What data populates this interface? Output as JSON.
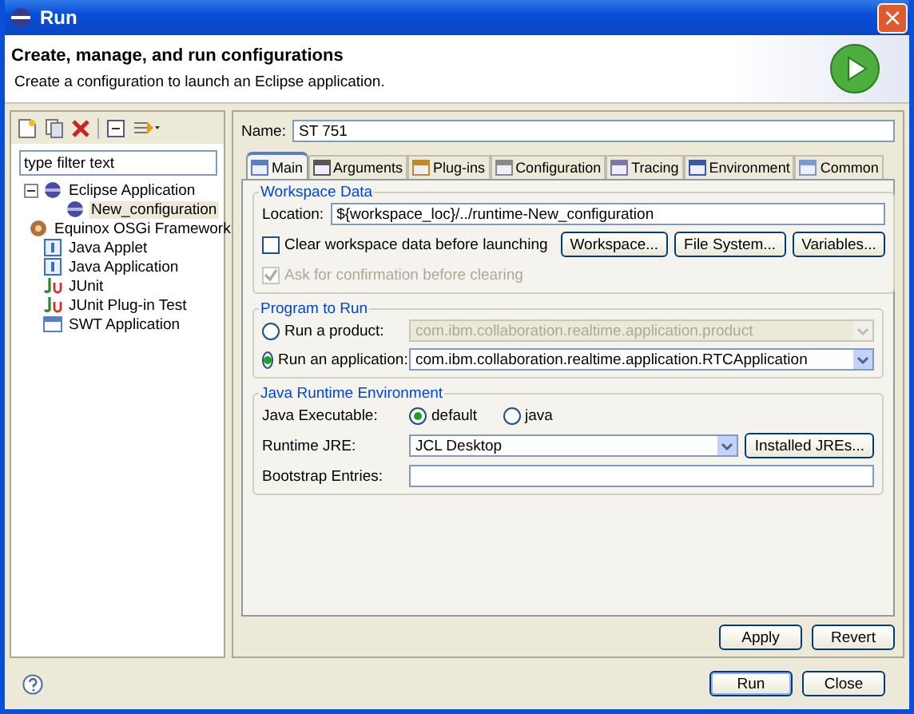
{
  "window": {
    "title": "Run",
    "close": "×"
  },
  "header": {
    "title": "Create, manage, and run configurations",
    "description": "Create a configuration to launch an Eclipse application."
  },
  "filter": {
    "placeholder": "type filter text"
  },
  "tree": [
    {
      "label": "Eclipse Application",
      "kind": "eclipse",
      "expanded": true,
      "selected": false,
      "children": [
        {
          "label": "New_configuration",
          "kind": "config",
          "selected": true
        }
      ]
    },
    {
      "label": "Equinox OSGi Framework",
      "kind": "osgi",
      "selected": false
    },
    {
      "label": "Java Applet",
      "kind": "applet",
      "selected": false
    },
    {
      "label": "Java Application",
      "kind": "java",
      "selected": false
    },
    {
      "label": "JUnit",
      "kind": "junit",
      "selected": false
    },
    {
      "label": "JUnit Plug-in Test",
      "kind": "junitplugin",
      "selected": false
    },
    {
      "label": "SWT Application",
      "kind": "swt",
      "selected": false
    }
  ],
  "name": {
    "label": "Name:",
    "value": "ST 751"
  },
  "tabs": [
    {
      "label": "Main",
      "kind": "main",
      "selected": true
    },
    {
      "label": "Arguments",
      "kind": "args",
      "selected": false
    },
    {
      "label": "Plug-ins",
      "kind": "plugins",
      "selected": false
    },
    {
      "label": "Configuration",
      "kind": "config",
      "selected": false
    },
    {
      "label": "Tracing",
      "kind": "tracing",
      "selected": false
    },
    {
      "label": "Environment",
      "kind": "env",
      "selected": false
    },
    {
      "label": "Common",
      "kind": "common",
      "selected": false
    }
  ],
  "workspace": {
    "title": "Workspace Data",
    "location_label": "Location:",
    "location": "${workspace_loc}/../runtime-New_configuration",
    "clear": {
      "label": "Clear workspace data before launching",
      "checked": false,
      "disabled": false
    },
    "buttons": [
      "Workspace...",
      "File System...",
      "Variables..."
    ],
    "ask": {
      "label": "Ask for confirmation before clearing",
      "checked": true,
      "disabled": true
    }
  },
  "program": {
    "title": "Program to Run",
    "options": [
      {
        "label": "Run a product:",
        "selected": false,
        "value": "com.ibm.collaboration.realtime.application.product"
      },
      {
        "label": "Run an application:",
        "selected": true,
        "value": "com.ibm.collaboration.realtime.application.RTCApplication"
      }
    ]
  },
  "jre": {
    "title": "Java Runtime Environment",
    "exec_label": "Java Executable:",
    "exec_options": [
      {
        "label": "default",
        "selected": true
      },
      {
        "label": "java",
        "selected": false
      }
    ],
    "runtime_label": "Runtime JRE:",
    "runtime": "JCL Desktop",
    "installed_button": "Installed JREs...",
    "bootstrap_label": "Bootstrap Entries:"
  },
  "panel_buttons": [
    "Apply",
    "Revert"
  ],
  "dialog_buttons": [
    "Run",
    "Close"
  ]
}
